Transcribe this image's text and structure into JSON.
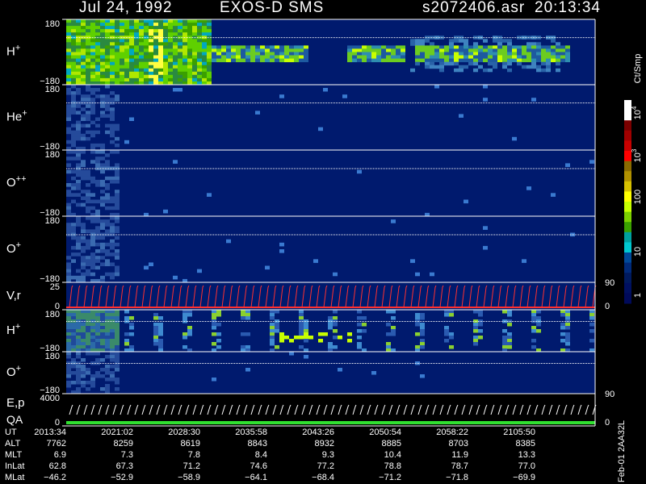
{
  "header": {
    "date": "Jul 24, 1992",
    "instrument": "EXOS-D SMS",
    "file": "s2072406.asr",
    "time": "20:13:34"
  },
  "colorbar": {
    "unit_label": "Ct/Smp",
    "tick_labels": [
      "10^4",
      "10^3",
      "100",
      "10",
      "1"
    ],
    "colors": [
      "#ffffff",
      "#ffffff",
      "#7a0000",
      "#a00000",
      "#c80000",
      "#ff0000",
      "#8a6a00",
      "#b09000",
      "#d6c000",
      "#ffff00",
      "#c8ff00",
      "#7cd000",
      "#3aa000",
      "#00a0a0",
      "#00c8d0",
      "#004a9a",
      "#002a7a",
      "#001a5e",
      "#001060",
      "#000a5a"
    ]
  },
  "panels": [
    {
      "id": "h-plus-1",
      "label": "H+",
      "ymax": "180",
      "ymin": "−180",
      "intensity": "high"
    },
    {
      "id": "he-plus",
      "label": "He+",
      "ymax": "180",
      "ymin": "−180",
      "intensity": "low"
    },
    {
      "id": "o-plus-plus",
      "label": "O++",
      "ymax": "180",
      "ymin": "−180",
      "intensity": "low"
    },
    {
      "id": "o-plus-1",
      "label": "O+",
      "ymax": "180",
      "ymin": "−180",
      "intensity": "low"
    },
    {
      "id": "vr",
      "label": "V,r",
      "ymax": "25",
      "ymin": "0",
      "right_max": "90",
      "right_min": "0"
    },
    {
      "id": "h-plus-2",
      "label": "H+",
      "ymax": "180",
      "ymin": "−180",
      "intensity": "medium"
    },
    {
      "id": "o-plus-2",
      "label": "O+",
      "ymax": "180",
      "ymin": "−180",
      "intensity": "low"
    },
    {
      "id": "epqa",
      "label": "E,p",
      "label2": "QA",
      "ymax": "4000",
      "ymin": "0",
      "right_max": "90",
      "right_min": "0"
    }
  ],
  "table": {
    "row_labels": [
      "UT",
      "ALT",
      "MLT",
      "InLat",
      "MLat"
    ],
    "columns": [
      {
        "UT": "2013:34",
        "ALT": "7762",
        "MLT": "6.9",
        "InLat": "62.8",
        "MLat": "−46.2"
      },
      {
        "UT": "2021:02",
        "ALT": "8259",
        "MLT": "7.3",
        "InLat": "67.3",
        "MLat": "−52.9"
      },
      {
        "UT": "2028:30",
        "ALT": "8619",
        "MLT": "7.8",
        "InLat": "71.2",
        "MLat": "−58.9"
      },
      {
        "UT": "2035:58",
        "ALT": "8843",
        "MLT": "8.4",
        "InLat": "74.6",
        "MLat": "−64.1"
      },
      {
        "UT": "2043:26",
        "ALT": "8932",
        "MLT": "9.3",
        "InLat": "77.2",
        "MLat": "−68.4"
      },
      {
        "UT": "2050:54",
        "ALT": "8885",
        "MLT": "10.4",
        "InLat": "78.8",
        "MLat": "−71.2"
      },
      {
        "UT": "2058:22",
        "ALT": "8703",
        "MLT": "11.9",
        "InLat": "78.7",
        "MLat": "−71.8"
      },
      {
        "UT": "2105:50",
        "ALT": "8385",
        "MLT": "13.3",
        "InLat": "77.0",
        "MLat": "−69.9"
      }
    ]
  },
  "footer": "Feb-01 2AA32L",
  "chart_data": {
    "type": "heatmap",
    "title": "Jul 24, 1992 EXOS-D SMS",
    "x_label": "UT",
    "x_ticks": [
      "2013:34",
      "2021:02",
      "2028:30",
      "2035:58",
      "2043:26",
      "2050:54",
      "2058:22",
      "2105:50"
    ],
    "panels": [
      "H+",
      "He+",
      "O++",
      "O+",
      "V,r",
      "H+",
      "O+",
      "E,p QA"
    ],
    "color_scale": "log",
    "color_range": [
      1,
      10000
    ],
    "color_unit": "Ct/Smp"
  }
}
